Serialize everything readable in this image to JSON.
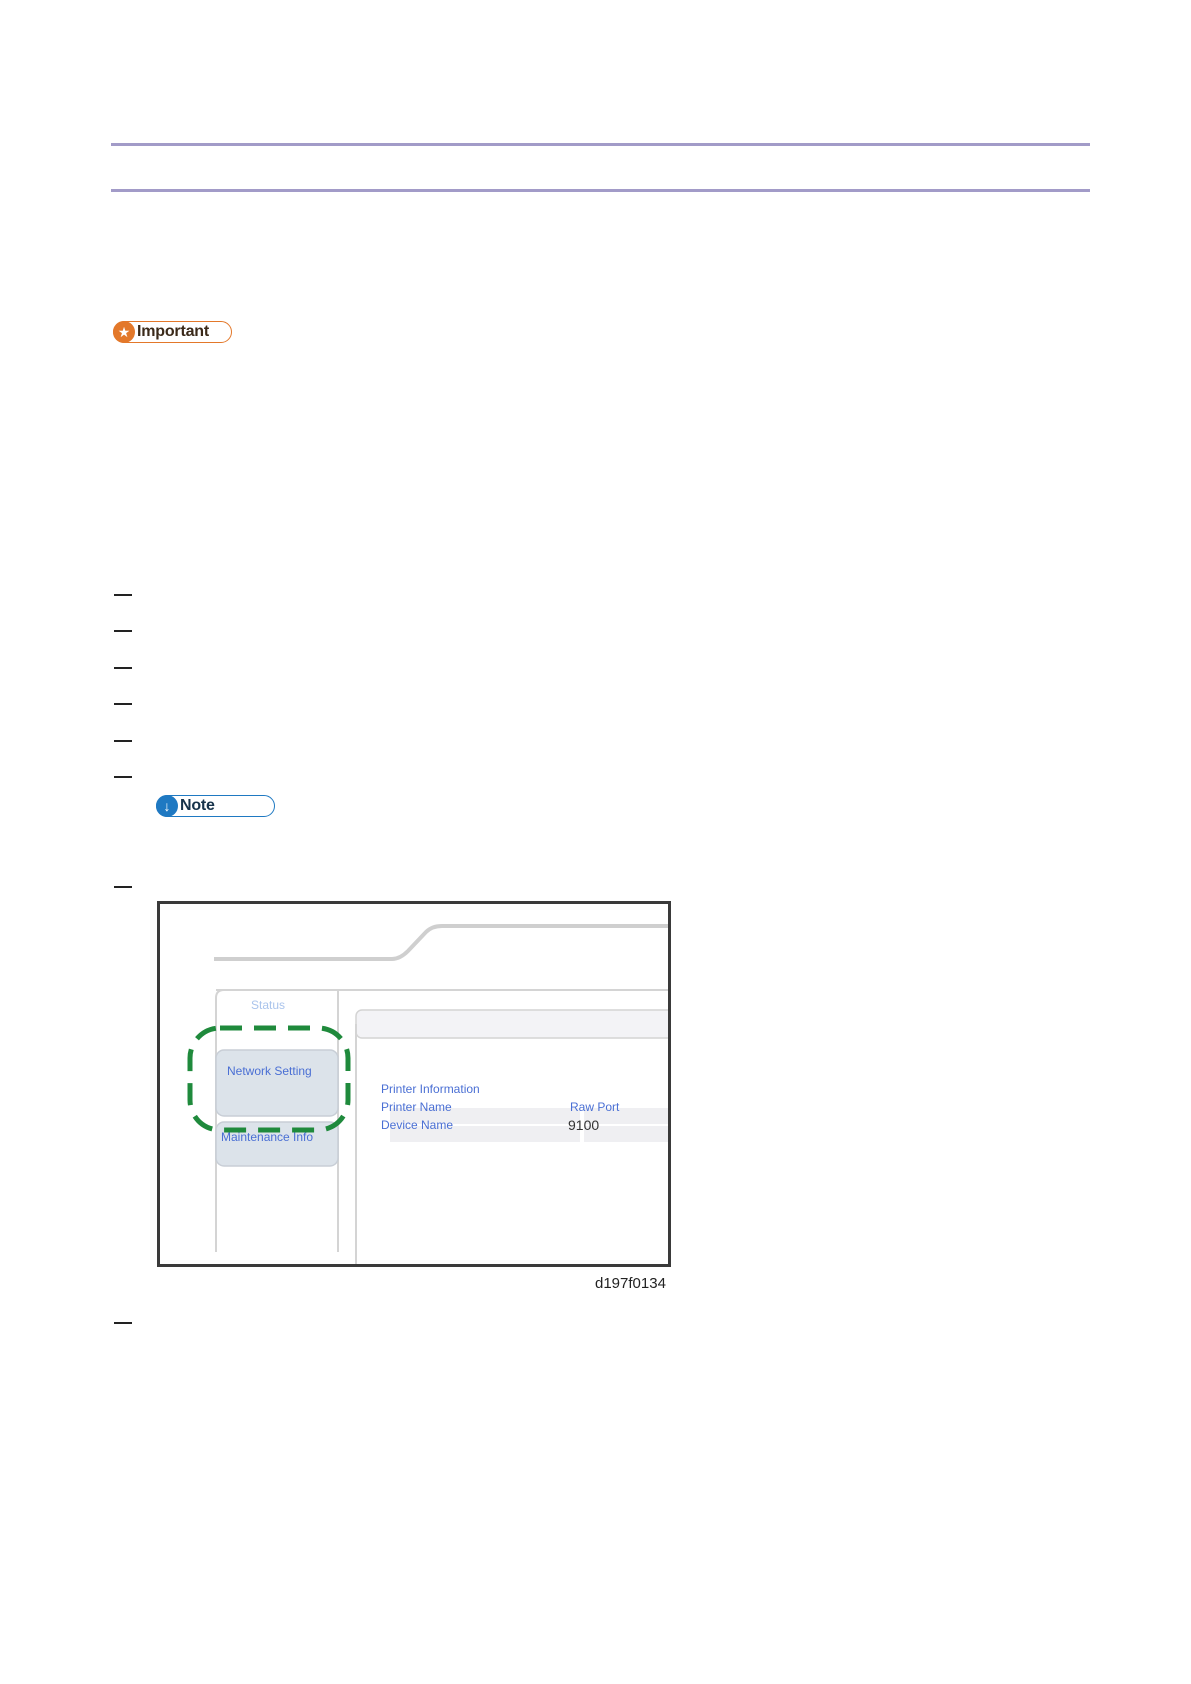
{
  "badges": {
    "important": "Important",
    "note": "Note"
  },
  "figure": {
    "tabs": {
      "status": "Status",
      "network_setting": "Network Setting",
      "maintenance_info": "Maintenance Info"
    },
    "printer_info": {
      "heading": "Printer Information",
      "rows": [
        {
          "label": "Printer Name",
          "value": "Raw Port"
        },
        {
          "label": "Device Name",
          "value": "9100"
        }
      ]
    },
    "caption": "d197f0134"
  },
  "icons": {
    "important": "star-icon",
    "note": "down-arrow-icon"
  },
  "colors": {
    "rule": "#a29bc8",
    "important": "#e3782a",
    "note": "#1f79c2",
    "highlight": "#1f8a3c",
    "link_text": "#4a6fd4"
  }
}
